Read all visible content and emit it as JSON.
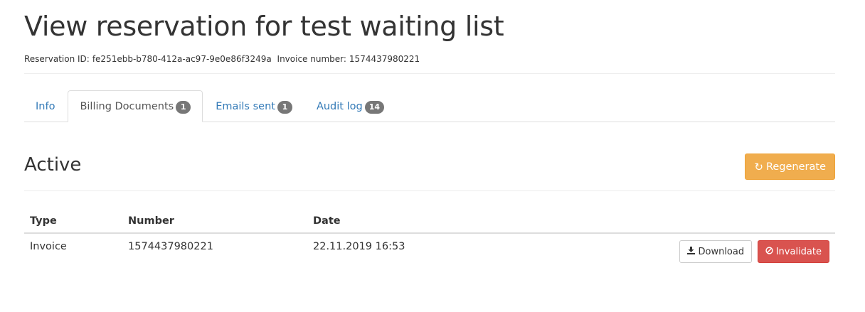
{
  "header": {
    "title": "View reservation for test waiting list",
    "reservation_id_label": "Reservation ID:",
    "reservation_id": "fe251ebb-b780-412a-ac97-9e0e86f3249a",
    "invoice_number_label": "Invoice number:",
    "invoice_number": "1574437980221"
  },
  "tabs": [
    {
      "label": "Info",
      "badge": null,
      "active": false
    },
    {
      "label": "Billing Documents",
      "badge": "1",
      "active": true
    },
    {
      "label": "Emails sent",
      "badge": "1",
      "active": false
    },
    {
      "label": "Audit log",
      "badge": "14",
      "active": false
    }
  ],
  "section": {
    "title": "Active",
    "regenerate_label": "Regenerate",
    "regenerate_icon": "refresh-icon"
  },
  "table": {
    "columns": [
      "Type",
      "Number",
      "Date",
      ""
    ],
    "rows": [
      {
        "type": "Invoice",
        "number": "1574437980221",
        "date": "22.11.2019 16:53",
        "download_label": "Download",
        "download_icon": "download-icon",
        "invalidate_label": "Invalidate",
        "invalidate_icon": "ban-icon"
      }
    ]
  },
  "colors": {
    "link": "#337ab7",
    "warning": "#f0ad4e",
    "danger": "#d9534f",
    "badge": "#777777"
  }
}
